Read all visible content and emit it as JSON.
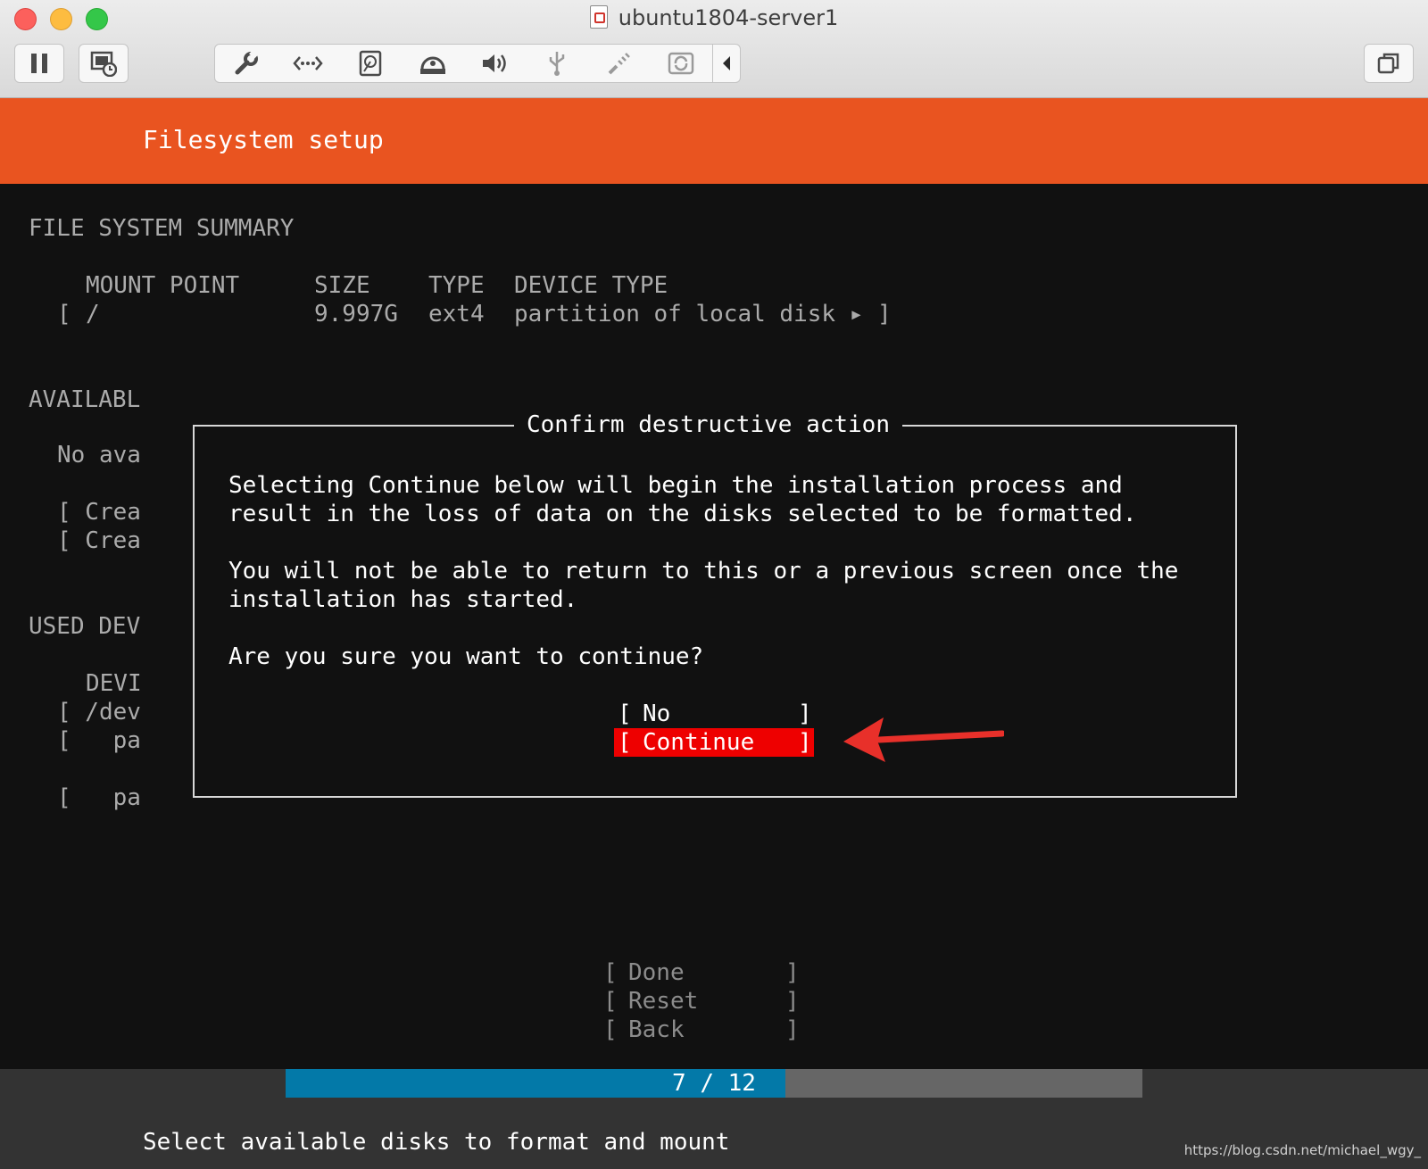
{
  "window": {
    "title": "ubuntu1804-server1"
  },
  "header": {
    "title": "Filesystem setup"
  },
  "summary": {
    "heading": "FILE SYSTEM SUMMARY",
    "columns": [
      "MOUNT POINT",
      "SIZE",
      "TYPE",
      "DEVICE TYPE"
    ],
    "row": {
      "open": "[",
      "mount": "/",
      "size": "9.997G",
      "type": "ext4",
      "device": "partition of local disk ▸ ]"
    }
  },
  "background_text": {
    "available_heading": "AVAILABL",
    "no_available": "No ava",
    "create1": "[ Crea",
    "create2": "[ Crea",
    "used_heading": "USED DEV",
    "devi": "DEVI",
    "dev": "[ /dev",
    "pa1": "[   pa",
    "pa2": "[   pa"
  },
  "dialog": {
    "title": "Confirm destructive action",
    "line1": "Selecting Continue below will begin the installation process and",
    "line2": "result in the loss of data on the disks selected to be formatted.",
    "line3": "You will not be able to return to this or a previous screen once the",
    "line4": "installation has started.",
    "question": "Are you sure you want to continue?",
    "no_label": "No",
    "continue_label": "Continue",
    "bracket_open": "[",
    "bracket_close": "]"
  },
  "footer_buttons": {
    "done": "Done",
    "reset": "Reset",
    "back": "Back"
  },
  "progress": {
    "label": "7 / 12",
    "current": 7,
    "total": 12
  },
  "status": {
    "text": "Select available disks to format and mount"
  },
  "watermark": "https://blog.csdn.net/michael_wgy_",
  "colors": {
    "header": "#e95420",
    "continue_highlight": "#ee0000",
    "progress_fill": "#0379a8",
    "arrow": "#e8302a"
  },
  "icons": {
    "toolbar": [
      "pause-icon",
      "snapshot-icon",
      "settings-wrench-icon",
      "network-icon",
      "hard-disk-icon",
      "optical-disk-icon",
      "sound-icon",
      "usb-icon",
      "serial-port-icon",
      "shared-folder-icon",
      "collapse-arrow-icon",
      "window-restore-icon"
    ]
  }
}
